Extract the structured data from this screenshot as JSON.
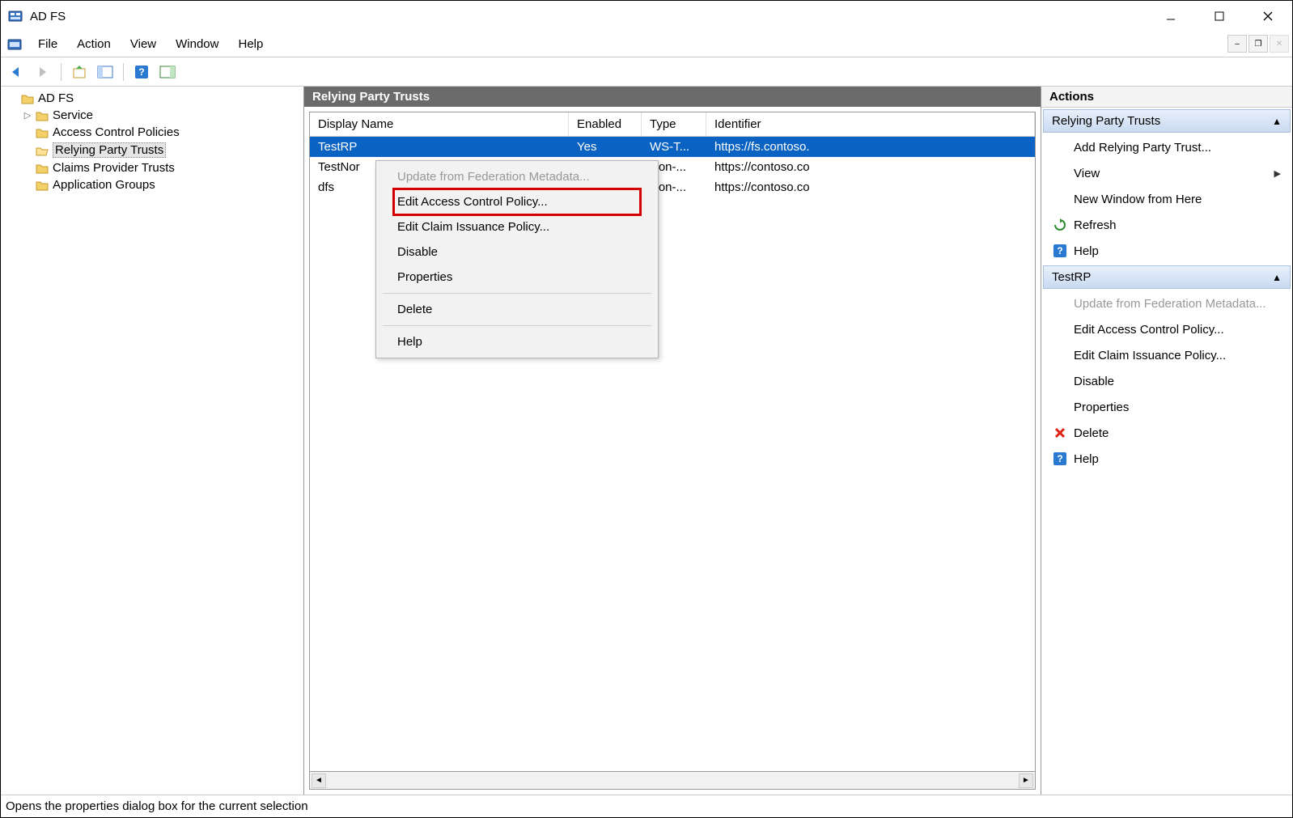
{
  "window": {
    "title": "AD FS"
  },
  "menubar": {
    "items": [
      "File",
      "Action",
      "View",
      "Window",
      "Help"
    ]
  },
  "tree": {
    "root": "AD FS",
    "items": [
      {
        "label": "Service",
        "expandable": true
      },
      {
        "label": "Access Control Policies",
        "expandable": false
      },
      {
        "label": "Relying Party Trusts",
        "expandable": false,
        "selected": true
      },
      {
        "label": "Claims Provider Trusts",
        "expandable": false
      },
      {
        "label": "Application Groups",
        "expandable": false
      }
    ]
  },
  "center": {
    "title": "Relying Party Trusts",
    "columns": {
      "name": "Display Name",
      "enabled": "Enabled",
      "type": "Type",
      "identifier": "Identifier"
    },
    "rows": [
      {
        "name": "TestRP",
        "enabled": "Yes",
        "type": "WS-T...",
        "identifier": "https://fs.contoso.",
        "selected": true
      },
      {
        "name": "TestNor",
        "enabled": "",
        "type": "Non-...",
        "identifier": "https://contoso.co",
        "selected": false
      },
      {
        "name": "dfs",
        "enabled": "",
        "type": "Non-...",
        "identifier": "https://contoso.co",
        "selected": false
      }
    ]
  },
  "context_menu": {
    "items": [
      {
        "label": "Update from Federation Metadata...",
        "disabled": true
      },
      {
        "label": "Edit Access Control Policy...",
        "highlight": true
      },
      {
        "label": "Edit Claim Issuance Policy..."
      },
      {
        "label": "Disable"
      },
      {
        "label": "Properties"
      },
      {
        "sep": true
      },
      {
        "label": "Delete"
      },
      {
        "sep": true
      },
      {
        "label": "Help"
      }
    ]
  },
  "actions": {
    "title": "Actions",
    "section1": {
      "header": "Relying Party Trusts",
      "items": [
        {
          "label": "Add Relying Party Trust..."
        },
        {
          "label": "View",
          "submenu": true
        },
        {
          "label": "New Window from Here"
        },
        {
          "label": "Refresh",
          "icon": "refresh"
        },
        {
          "label": "Help",
          "icon": "help"
        }
      ]
    },
    "section2": {
      "header": "TestRP",
      "items": [
        {
          "label": "Update from Federation Metadata...",
          "disabled": true
        },
        {
          "label": "Edit Access Control Policy..."
        },
        {
          "label": "Edit Claim Issuance Policy..."
        },
        {
          "label": "Disable"
        },
        {
          "label": "Properties"
        },
        {
          "label": "Delete",
          "icon": "delete"
        },
        {
          "label": "Help",
          "icon": "help"
        }
      ]
    }
  },
  "statusbar": {
    "text": "Opens the properties dialog box for the current selection"
  }
}
